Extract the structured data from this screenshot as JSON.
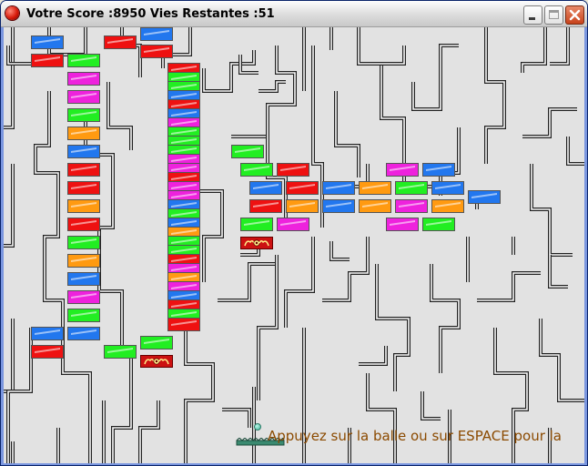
{
  "window": {
    "title": "Votre Score :8950 Vies Restantes :51",
    "close_glyph": "close-icon",
    "minimize_glyph": "minimize-icon",
    "maximize_glyph": "maximize-icon"
  },
  "game": {
    "score": 8950,
    "lives": 51,
    "hint": "Appuyez sur la balle ou sur ESPACE pour la"
  },
  "colors": {
    "red": "#ee1111",
    "green": "#22ee22",
    "magenta": "#ee22dd",
    "orange": "#ff9a11",
    "blue": "#2277ee",
    "special": "#cc1111",
    "playfield": "#e2e2e2",
    "hint": "#8b4a00"
  },
  "bricks": [
    {
      "color": "blue"
    },
    {
      "color": "red"
    },
    {
      "color": "red"
    },
    {
      "color": "blue"
    },
    {
      "color": "red"
    },
    {
      "color": "green"
    },
    {
      "color": "magenta"
    },
    {
      "color": "magenta"
    },
    {
      "color": "green"
    },
    {
      "color": "orange"
    },
    {
      "color": "blue"
    },
    {
      "color": "red"
    },
    {
      "color": "red"
    },
    {
      "color": "orange"
    },
    {
      "color": "red"
    },
    {
      "color": "green"
    },
    {
      "color": "orange"
    },
    {
      "color": "blue"
    },
    {
      "color": "magenta"
    },
    {
      "color": "green"
    },
    {
      "color": "blue"
    },
    {
      "color": "red"
    },
    {
      "color": "blue"
    },
    {
      "color": "green"
    },
    {
      "color": "green"
    },
    {
      "color": "red"
    },
    {
      "color": "green"
    },
    {
      "color": "green"
    },
    {
      "color": "blue"
    },
    {
      "color": "red"
    },
    {
      "color": "blue"
    },
    {
      "color": "magenta"
    },
    {
      "color": "green"
    },
    {
      "color": "green"
    },
    {
      "color": "green"
    },
    {
      "color": "magenta"
    },
    {
      "color": "magenta"
    },
    {
      "color": "red"
    },
    {
      "color": "magenta"
    },
    {
      "color": "magenta"
    },
    {
      "color": "blue"
    },
    {
      "color": "green"
    },
    {
      "color": "blue"
    },
    {
      "color": "orange"
    },
    {
      "color": "green"
    },
    {
      "color": "green"
    },
    {
      "color": "red"
    },
    {
      "color": "magenta"
    },
    {
      "color": "orange"
    },
    {
      "color": "magenta"
    },
    {
      "color": "blue"
    },
    {
      "color": "red"
    },
    {
      "color": "green"
    },
    {
      "color": "red"
    },
    {
      "color": "green"
    },
    {
      "color": "green"
    },
    {
      "color": "red"
    },
    {
      "color": "blue"
    },
    {
      "color": "red"
    },
    {
      "color": "blue"
    },
    {
      "color": "orange"
    },
    {
      "color": "green"
    },
    {
      "color": "blue"
    },
    {
      "color": "blue"
    },
    {
      "color": "red"
    },
    {
      "color": "orange"
    },
    {
      "color": "blue"
    },
    {
      "color": "orange"
    },
    {
      "color": "magenta"
    },
    {
      "color": "orange"
    },
    {
      "color": "magenta"
    },
    {
      "color": "blue"
    },
    {
      "color": "green"
    },
    {
      "color": "magenta"
    },
    {
      "color": "magenta"
    },
    {
      "color": "green"
    },
    {
      "color": "green"
    }
  ],
  "special_bricks": [
    {
      "kind": "monster"
    },
    {
      "kind": "monster"
    }
  ]
}
